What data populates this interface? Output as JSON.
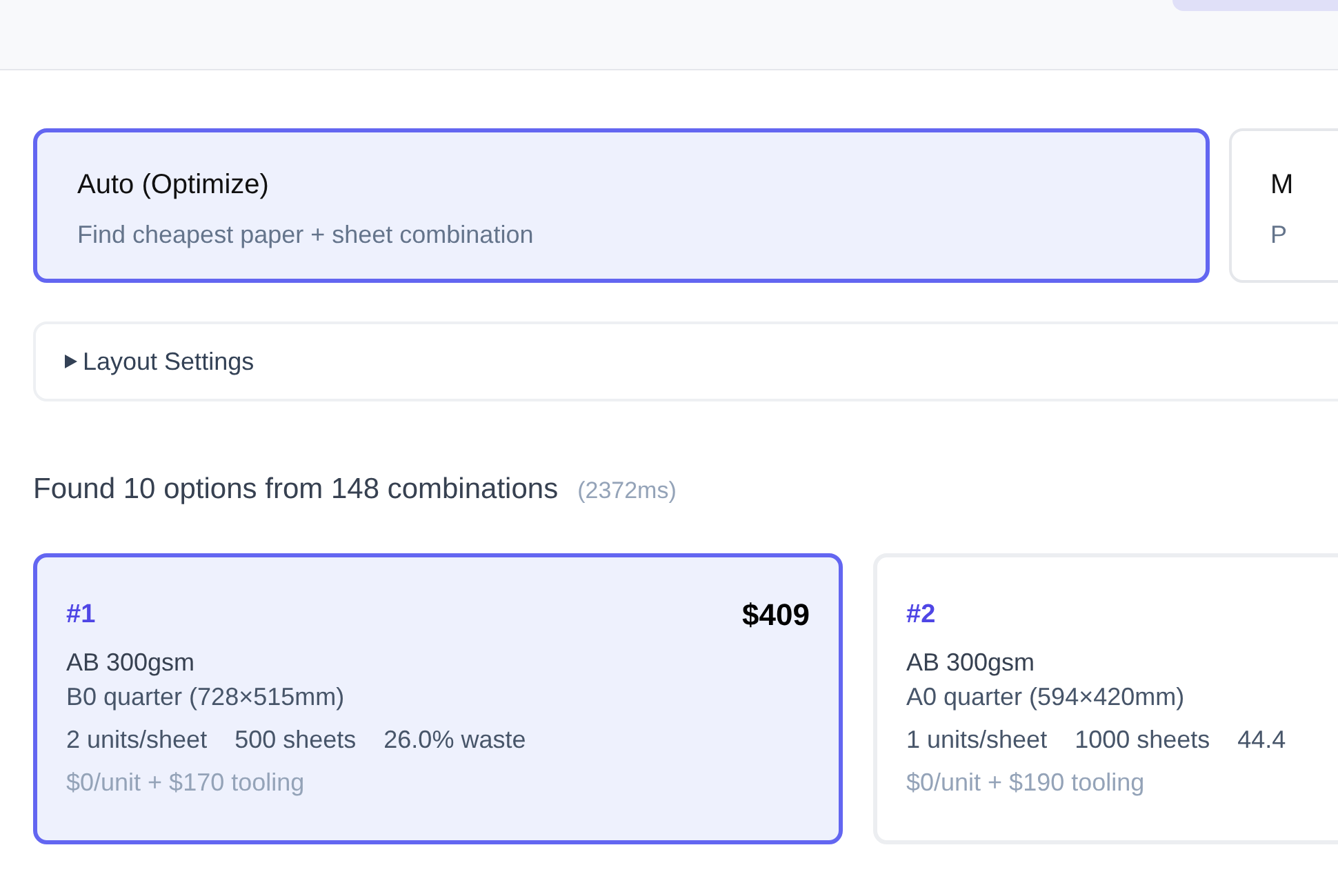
{
  "modes": [
    {
      "title": "Auto (Optimize)",
      "description": "Find cheapest paper + sheet combination",
      "selected": true
    },
    {
      "title": "M",
      "description": "P",
      "selected": false
    }
  ],
  "layout_settings": {
    "label": "Layout Settings",
    "expanded": false
  },
  "summary": {
    "text": "Found 10 options from 148 combinations",
    "timing": "(2372ms)"
  },
  "results": [
    {
      "rank": "#1",
      "price": "$409",
      "paper": "AB 300gsm",
      "sheet": "B0 quarter (728×515mm)",
      "stats": [
        "2 units/sheet",
        "500 sheets",
        "26.0% waste"
      ],
      "cost": "$0/unit + $170 tooling",
      "selected": true
    },
    {
      "rank": "#2",
      "paper": "AB 300gsm",
      "sheet": "A0 quarter (594×420mm)",
      "stats": [
        "1 units/sheet",
        "1000 sheets",
        "44.4"
      ],
      "cost": "$0/unit + $190 tooling",
      "selected": false
    }
  ]
}
